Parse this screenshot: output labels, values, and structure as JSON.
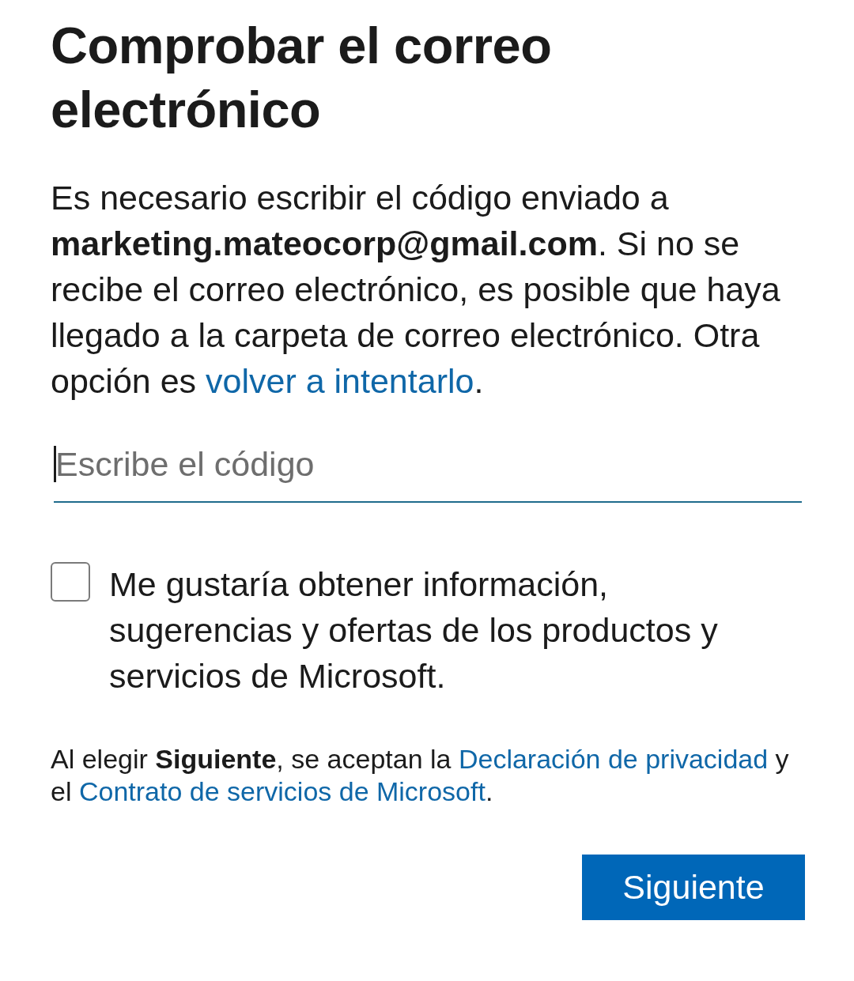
{
  "title": "Comprobar el correo electrónico",
  "intro": {
    "text": "Es necesario escribir el código enviado a **marketing.mateocorp@gmail.com**. Si no se recibe el correo electrónico, es posible que haya llegado a la carpeta de correo electrónico. Otra opción es ",
    "link": "volver a intentarlo",
    "after": "."
  },
  "code_field": {
    "placeholder": "Escribe el código",
    "focused": true
  },
  "consent": {
    "label": "Me gustaría obtener información, sugerencias y ofertas de los productos y servicios de Microsoft.",
    "checked": false
  },
  "legal": {
    "parts": [
      {
        "kind": "text",
        "text": "Al elegir **Siguiente**, se aceptan la "
      },
      {
        "kind": "link",
        "text": "Declaración de privacidad"
      },
      {
        "kind": "text",
        "text": " y el "
      },
      {
        "kind": "link",
        "text": "Contrato de servicios de Microsoft"
      },
      {
        "kind": "text",
        "text": "."
      }
    ]
  },
  "buttons": [
    {
      "label": "Siguiente",
      "kind": "primary"
    }
  ]
}
